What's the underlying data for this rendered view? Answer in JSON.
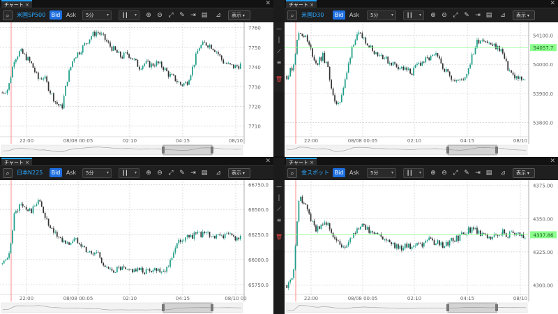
{
  "tab_label": "チャート",
  "tab_close": "×",
  "panel_close": "✕",
  "bid_label": "Bid",
  "ask_label": "Ask",
  "timeframe": "5分",
  "display_label": "表示",
  "colors": {
    "up": "#1f9e89",
    "down": "#333333",
    "accent": "#1e6fe0",
    "now_line": "#ff6b6b",
    "price_line": "#8cff8c"
  },
  "panels": [
    {
      "symbol": "米国SP500",
      "x_ticks": [
        "22:00",
        "08/08 00:05",
        "02:10",
        "04:15",
        "08/10"
      ],
      "chart_data": {
        "type": "candlestick",
        "title": "米国SP500",
        "y_ticks": [
          7760,
          7750,
          7740,
          7730,
          7720,
          7710
        ],
        "ylim": [
          7706,
          7762
        ],
        "current_price": "",
        "trend": [
          7727,
          7729,
          7744,
          7748,
          7745,
          7741,
          7734,
          7735,
          7728,
          7722,
          7719,
          7735,
          7745,
          7748,
          7752,
          7756,
          7758,
          7755,
          7751,
          7748,
          7745,
          7747,
          7744,
          7740,
          7742,
          7741,
          7742,
          7740,
          7736,
          7734,
          7731,
          7732,
          7740,
          7750,
          7752,
          7751,
          7748,
          7743,
          7741,
          7740,
          7741
        ]
      }
    },
    {
      "symbol": "米国D30",
      "x_ticks": [
        "22:00",
        "08/08 00:05",
        "02:10",
        "04:15",
        "08/10"
      ],
      "chart_data": {
        "type": "candlestick",
        "title": "米国D30",
        "y_ticks": [
          54100,
          54000,
          53900,
          53800
        ],
        "y_tick_labels": [
          "54100.0",
          "54000.0",
          "53900.0",
          "53800.0"
        ],
        "ylim": [
          53760,
          54140
        ],
        "current_price": "54057.7",
        "trend": [
          53960,
          53990,
          54110,
          54100,
          54050,
          54000,
          54030,
          53980,
          53860,
          53880,
          53960,
          54070,
          54100,
          54090,
          54060,
          54040,
          54030,
          54010,
          54000,
          53990,
          53980,
          53970,
          54000,
          54010,
          54020,
          54030,
          54000,
          53970,
          53950,
          53940,
          53960,
          54020,
          54080,
          54090,
          54070,
          54060,
          54050,
          53990,
          53960,
          53950,
          53940
        ]
      }
    },
    {
      "symbol": "日本N225",
      "x_ticks": [
        "22:00",
        "08/08 00:05",
        "02:10",
        "04:15",
        "08/10 00"
      ],
      "chart_data": {
        "type": "candlestick",
        "title": "日本N225",
        "y_ticks": [
          66750,
          66500,
          66250,
          66000,
          65750
        ],
        "y_tick_labels": [
          "66750.0",
          "66500.0",
          "66250.0",
          "66000.0",
          "65750.0"
        ],
        "ylim": [
          65680,
          66780
        ],
        "current_price": "",
        "trend": [
          65960,
          65990,
          66440,
          66550,
          66500,
          66480,
          66600,
          66470,
          66300,
          66250,
          66200,
          66150,
          66200,
          66180,
          66100,
          66050,
          66080,
          65950,
          65880,
          65900,
          65910,
          65880,
          65900,
          65890,
          65880,
          65900,
          65910,
          65890,
          65950,
          66120,
          66200,
          66220,
          66240,
          66250,
          66260,
          66240,
          66230,
          66240,
          66250,
          66220,
          66210
        ]
      }
    },
    {
      "symbol": "金スポット",
      "x_ticks": [
        "22:00",
        "08/08 00:05",
        "02:10",
        "04:15",
        "08/10"
      ],
      "chart_data": {
        "type": "candlestick",
        "title": "金スポット",
        "y_ticks": [
          4375,
          4350,
          4325,
          4300
        ],
        "y_tick_labels": [
          "4375.00",
          "4350.00",
          "4325.00",
          "4300.00"
        ],
        "ylim": [
          4295,
          4378
        ],
        "current_price": "4337.86",
        "trend": [
          4300,
          4305,
          4365,
          4362,
          4350,
          4342,
          4348,
          4345,
          4335,
          4330,
          4328,
          4338,
          4342,
          4345,
          4340,
          4338,
          4336,
          4334,
          4330,
          4328,
          4330,
          4328,
          4332,
          4330,
          4334,
          4332,
          4330,
          4332,
          4334,
          4336,
          4340,
          4342,
          4340,
          4338,
          4336,
          4338,
          4340,
          4338,
          4339,
          4338,
          4338
        ]
      }
    }
  ]
}
